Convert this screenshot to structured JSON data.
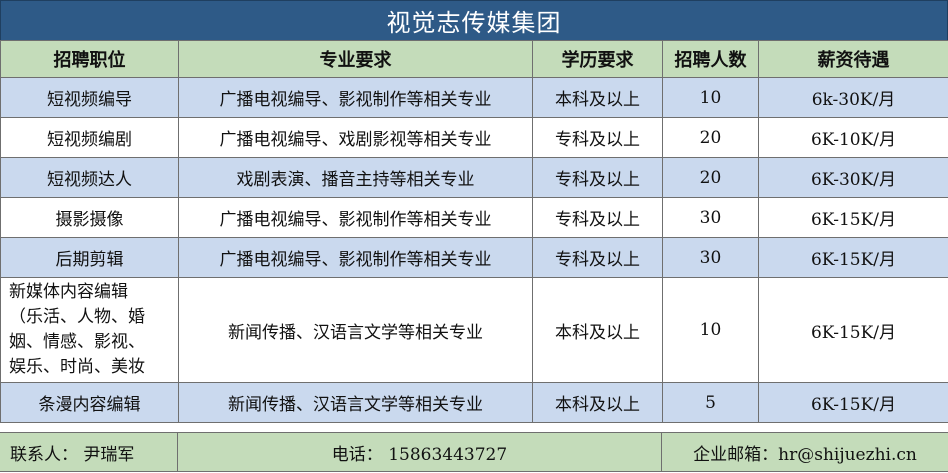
{
  "title": "视觉志传媒集团",
  "headers": [
    "招聘职位",
    "专业要求",
    "学历要求",
    "招聘人数",
    "薪资待遇"
  ],
  "rows": [
    {
      "position": "短视频编导",
      "major": "广播电视编导、影视制作等相关专业",
      "education": "本科及以上",
      "count": "10",
      "salary": "6k-30K/月"
    },
    {
      "position": "短视频编剧",
      "major": "广播电视编导、戏剧影视等相关专业",
      "education": "专科及以上",
      "count": "20",
      "salary": "6K-10K/月"
    },
    {
      "position": "短视频达人",
      "major": "戏剧表演、播音主持等相关专业",
      "education": "专科及以上",
      "count": "20",
      "salary": "6K-30K/月"
    },
    {
      "position": "摄影摄像",
      "major": "广播电视编导、影视制作等相关专业",
      "education": "专科及以上",
      "count": "30",
      "salary": "6K-15K/月"
    },
    {
      "position": "后期剪辑",
      "major": "广播电视编导、影视制作等相关专业",
      "education": "专科及以上",
      "count": "30",
      "salary": "6K-15K/月"
    },
    {
      "position_lines": [
        "新媒体内容编辑",
        "（乐活、人物、婚",
        "姻、情感、影视、",
        "娱乐、时尚、美妆"
      ],
      "major": "新闻传播、汉语言文学等相关专业",
      "education": "本科及以上",
      "count": "10",
      "salary": "6K-15K/月"
    },
    {
      "position": "条漫内容编辑",
      "major": "新闻传播、汉语言文学等相关专业",
      "education": "本科及以上",
      "count": "5",
      "salary": "6K-15K/月"
    }
  ],
  "footer": {
    "contact": "联系人：  尹瑞军",
    "phone": "电话：  15863443727",
    "email": "企业邮箱：hr@shijuezhi.cn"
  }
}
